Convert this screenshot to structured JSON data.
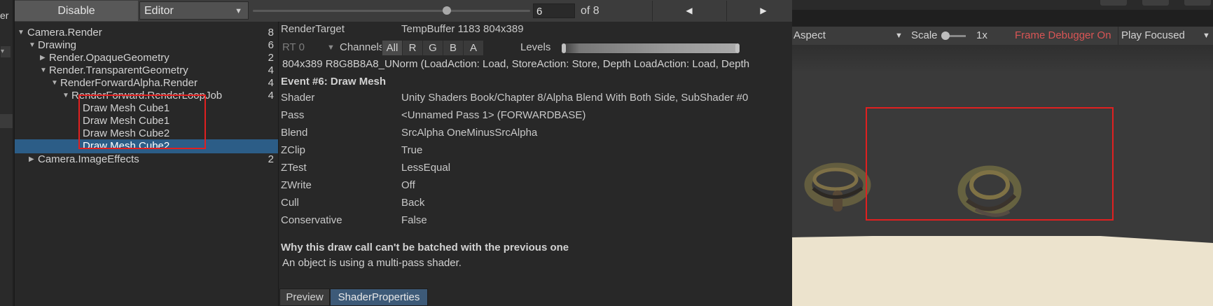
{
  "left_sliver": {
    "fragment": "er"
  },
  "toolbar": {
    "disable_label": "Disable",
    "target_select": "Editor",
    "event_index": "6",
    "event_total": "of 8",
    "prev_icon": "◀",
    "next_icon": "▶"
  },
  "tree": {
    "rows": [
      {
        "label": "Camera.Render",
        "count": "8"
      },
      {
        "label": "Drawing",
        "count": "6"
      },
      {
        "label": "Render.OpaqueGeometry",
        "count": "2"
      },
      {
        "label": "Render.TransparentGeometry",
        "count": "4"
      },
      {
        "label": "RenderForwardAlpha.Render",
        "count": "4"
      },
      {
        "label": "RenderForward.RenderLoopJob",
        "count": "4"
      },
      {
        "label": "Draw Mesh Cube1",
        "count": ""
      },
      {
        "label": "Draw Mesh Cube1",
        "count": ""
      },
      {
        "label": "Draw Mesh Cube2",
        "count": ""
      },
      {
        "label": "Draw Mesh Cube2",
        "count": ""
      },
      {
        "label": "Camera.ImageEffects",
        "count": "2"
      }
    ]
  },
  "details": {
    "render_target_label": "RenderTarget",
    "render_target_value": "TempBuffer 1183 804x389",
    "rt_select": "RT 0",
    "channels_label": "Channels",
    "channels": [
      "All",
      "R",
      "G",
      "B",
      "A"
    ],
    "levels_label": "Levels",
    "format_line": "804x389 R8G8B8A8_UNorm (LoadAction: Load, StoreAction: Store, Depth LoadAction: Load, Depth",
    "event_title": "Event #6: Draw Mesh",
    "properties": [
      {
        "label": "Shader",
        "value": "Unity Shaders Book/Chapter 8/Alpha Blend With Both Side, SubShader #0"
      },
      {
        "label": "Pass",
        "value": "<Unnamed Pass 1> (FORWARDBASE)"
      },
      {
        "label": "Blend",
        "value": "SrcAlpha OneMinusSrcAlpha"
      },
      {
        "label": "ZClip",
        "value": "True"
      },
      {
        "label": "ZTest",
        "value": "LessEqual"
      },
      {
        "label": "ZWrite",
        "value": "Off"
      },
      {
        "label": "Cull",
        "value": "Back"
      },
      {
        "label": "Conservative",
        "value": "False"
      }
    ],
    "why_title": "Why this draw call can't be batched with the previous one",
    "why_text": "An object is using a multi-pass shader.",
    "tabs": [
      "Preview",
      "ShaderProperties"
    ]
  },
  "game": {
    "aspect": "Aspect",
    "scale_label": "Scale",
    "scale_value": "1x",
    "frame_debugger_status": "Frame Debugger On",
    "play_mode": "Play Focused"
  },
  "colors": {
    "selection": "#2c5d87",
    "highlight_box": "#e02020",
    "frame_debugger_on": "#d95555",
    "active_tab": "#3d5a78"
  }
}
